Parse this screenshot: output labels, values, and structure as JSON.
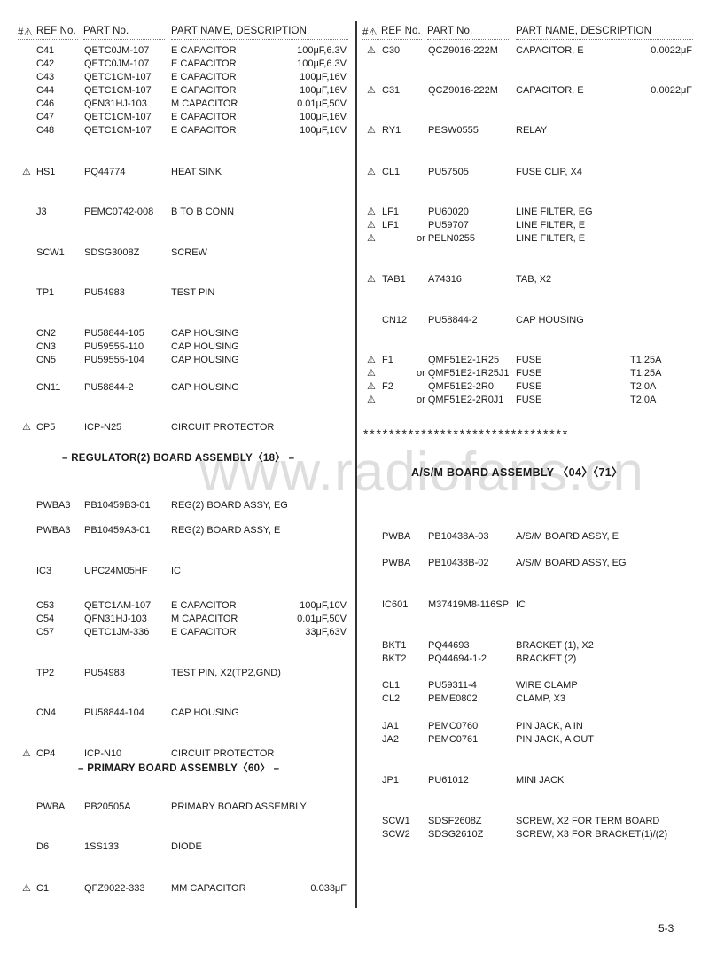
{
  "header": {
    "symbol": "#⚠",
    "ref_label": "REF No.",
    "part_label": "PART No.",
    "desc_label": "PART NAME, DESCRIPTION"
  },
  "left_rows": [
    {
      "warn": "",
      "ref": "C41",
      "part": "QETC0JM-107",
      "desc": "E  CAPACITOR",
      "value": "100μF,6.3V"
    },
    {
      "warn": "",
      "ref": "C42",
      "part": "QETC0JM-107",
      "desc": "E  CAPACITOR",
      "value": "100μF,6.3V"
    },
    {
      "warn": "",
      "ref": "C43",
      "part": "QETC1CM-107",
      "desc": "E  CAPACITOR",
      "value": "100μF,16V"
    },
    {
      "warn": "",
      "ref": "C44",
      "part": "QETC1CM-107",
      "desc": "E  CAPACITOR",
      "value": "100μF,16V"
    },
    {
      "warn": "",
      "ref": "C46",
      "part": "QFN31HJ-103",
      "desc": "M  CAPACITOR",
      "value": "0.01μF,50V"
    },
    {
      "warn": "",
      "ref": "C47",
      "part": "QETC1CM-107",
      "desc": "E  CAPACITOR",
      "value": "100μF,16V"
    },
    {
      "warn": "",
      "ref": "C48",
      "part": "QETC1CM-107",
      "desc": "E  CAPACITOR",
      "value": "100μF,16V"
    },
    {
      "warn": "⚠",
      "ref": "HS1",
      "part": "PQ44774",
      "desc": "HEAT  SINK",
      "value": ""
    },
    {
      "warn": "",
      "ref": "J3",
      "part": "PEMC0742-008",
      "desc": "B  TO  B  CONN",
      "value": ""
    },
    {
      "warn": "",
      "ref": "SCW1",
      "part": "SDSG3008Z",
      "desc": "SCREW",
      "value": ""
    },
    {
      "warn": "",
      "ref": "TP1",
      "part": "PU54983",
      "desc": "TEST  PIN",
      "value": ""
    },
    {
      "warn": "",
      "ref": "CN2",
      "part": "PU58844-105",
      "desc": "CAP  HOUSING",
      "value": ""
    },
    {
      "warn": "",
      "ref": "CN3",
      "part": "PU59555-110",
      "desc": "CAP  HOUSING",
      "value": ""
    },
    {
      "warn": "",
      "ref": "CN5",
      "part": "PU59555-104",
      "desc": "CAP  HOUSING",
      "value": ""
    },
    {
      "warn": "",
      "ref": "CN11",
      "part": "PU58844-2",
      "desc": "CAP  HOUSING",
      "value": ""
    },
    {
      "warn": "⚠",
      "ref": "CP5",
      "part": "ICP-N25",
      "desc": "CIRCUIT PROTECTOR",
      "value": ""
    },
    {
      "warn": "",
      "ref": "PWBA3",
      "part": "PB10459B3-01",
      "desc": "REG(2)  BOARD  ASSY,  EG",
      "value": ""
    },
    {
      "warn": "",
      "ref": "PWBA3",
      "part": "PB10459A3-01",
      "desc": "REG(2)  BOARD  ASSY,  E",
      "value": ""
    },
    {
      "warn": "",
      "ref": "IC3",
      "part": "UPC24M05HF",
      "desc": "IC",
      "value": ""
    },
    {
      "warn": "",
      "ref": "C53",
      "part": "QETC1AM-107",
      "desc": "E  CAPACITOR",
      "value": "100μF,10V"
    },
    {
      "warn": "",
      "ref": "C54",
      "part": "QFN31HJ-103",
      "desc": "M  CAPACITOR",
      "value": "0.01μF,50V"
    },
    {
      "warn": "",
      "ref": "C57",
      "part": "QETC1JM-336",
      "desc": "E  CAPACITOR",
      "value": "33μF,63V"
    },
    {
      "warn": "",
      "ref": "TP2",
      "part": "PU54983",
      "desc": "TEST  PIN,  X2(TP2,GND)",
      "value": ""
    },
    {
      "warn": "",
      "ref": "CN4",
      "part": "PU58844-104",
      "desc": "CAP  HOUSING",
      "value": ""
    },
    {
      "warn": "⚠",
      "ref": "CP4",
      "part": "ICP-N10",
      "desc": "CIRCUIT  PROTECTOR",
      "value": ""
    },
    {
      "warn": "",
      "ref": "PWBA",
      "part": "PB20505A",
      "desc": "PRIMARY  BOARD  ASSEMBLY",
      "value": ""
    },
    {
      "warn": "",
      "ref": "D6",
      "part": "1SS133",
      "desc": "DIODE",
      "value": ""
    },
    {
      "warn": "⚠",
      "ref": "C1",
      "part": "QFZ9022-333",
      "desc": "MM  CAPACITOR",
      "value": "0.033μF"
    }
  ],
  "right_rows": [
    {
      "warn": "⚠",
      "ref": "C30",
      "part": "QCZ9016-222M",
      "desc": "CAPACITOR,  E",
      "value": "0.0022μF"
    },
    {
      "warn": "⚠",
      "ref": "C31",
      "part": "QCZ9016-222M",
      "desc": "CAPACITOR,  E",
      "value": "0.0022μF"
    },
    {
      "warn": "⚠",
      "ref": "RY1",
      "part": "PESW0555",
      "desc": "RELAY",
      "value": ""
    },
    {
      "warn": "⚠",
      "ref": "CL1",
      "part": "PU57505",
      "desc": "FUSE  CLIP,  X4",
      "value": ""
    },
    {
      "warn": "⚠",
      "ref": "LF1",
      "part": "PU60020",
      "desc": "LINE  FILTER,  EG",
      "value": ""
    },
    {
      "warn": "⚠",
      "ref": "LF1",
      "part": "PU59707",
      "desc": "LINE  FILTER,  E",
      "value": ""
    },
    {
      "warn": "⚠",
      "ref": "",
      "part": "or PELN0255",
      "desc": "LINE  FILTER,  E",
      "value": ""
    },
    {
      "warn": "⚠",
      "ref": "TAB1",
      "part": "A74316",
      "desc": "TAB,  X2",
      "value": ""
    },
    {
      "warn": "",
      "ref": "CN12",
      "part": "PU58844-2",
      "desc": "CAP  HOUSING",
      "value": ""
    },
    {
      "warn": "⚠",
      "ref": "F1",
      "part": "QMF51E2-1R25",
      "desc": "FUSE",
      "value": "T1.25A"
    },
    {
      "warn": "⚠",
      "ref": "",
      "part": "or QMF51E2-1R25J1",
      "desc": "FUSE",
      "value": "T1.25A"
    },
    {
      "warn": "⚠",
      "ref": "F2",
      "part": "QMF51E2-2R0",
      "desc": "FUSE",
      "value": "T2.0A"
    },
    {
      "warn": "⚠",
      "ref": "",
      "part": "or QMF51E2-2R0J1",
      "desc": "FUSE",
      "value": "T2.0A"
    },
    {
      "warn": "",
      "ref": "PWBA",
      "part": "PB10438A-03",
      "desc": "A/S/M  BOARD  ASSY,  E",
      "value": ""
    },
    {
      "warn": "",
      "ref": "PWBA",
      "part": "PB10438B-02",
      "desc": "A/S/M  BOARD  ASSY,  EG",
      "value": ""
    },
    {
      "warn": "",
      "ref": "IC601",
      "part": "M37419M8-116SP",
      "desc": "IC",
      "value": ""
    },
    {
      "warn": "",
      "ref": "BKT1",
      "part": "PQ44693",
      "desc": "BRACKET  (1),  X2",
      "value": ""
    },
    {
      "warn": "",
      "ref": "BKT2",
      "part": "PQ44694-1-2",
      "desc": "BRACKET  (2)",
      "value": ""
    },
    {
      "warn": "",
      "ref": "CL1",
      "part": "PU59311-4",
      "desc": "WIRE  CLAMP",
      "value": ""
    },
    {
      "warn": "",
      "ref": "CL2",
      "part": "PEME0802",
      "desc": "CLAMP,  X3",
      "value": ""
    },
    {
      "warn": "",
      "ref": "JA1",
      "part": "PEMC0760",
      "desc": "PIN  JACK,  A  IN",
      "value": ""
    },
    {
      "warn": "",
      "ref": "JA2",
      "part": "PEMC0761",
      "desc": "PIN  JACK,  A  OUT",
      "value": ""
    },
    {
      "warn": "",
      "ref": "JP1",
      "part": "PU61012",
      "desc": "MINI  JACK",
      "value": ""
    },
    {
      "warn": "",
      "ref": "SCW1",
      "part": "SDSF2608Z",
      "desc": "SCREW,  X2  FOR  TERM  BOARD",
      "value": ""
    },
    {
      "warn": "",
      "ref": "SCW2",
      "part": "SDSG2610Z",
      "desc": "SCREW,  X3  FOR  BRACKET(1)/(2)",
      "value": ""
    }
  ],
  "sections": {
    "regulator": "–  REGULATOR(2)  BOARD  ASSEMBLY〈18〉  –",
    "primary": "–  PRIMARY  BOARD  ASSEMBLY〈60〉  –",
    "asm": "A/S/M  BOARD  ASSEMBLY  〈04〉〈71〉"
  },
  "separator": "********************************",
  "watermark": "www.radiofans.cn",
  "page_number": "5-3"
}
